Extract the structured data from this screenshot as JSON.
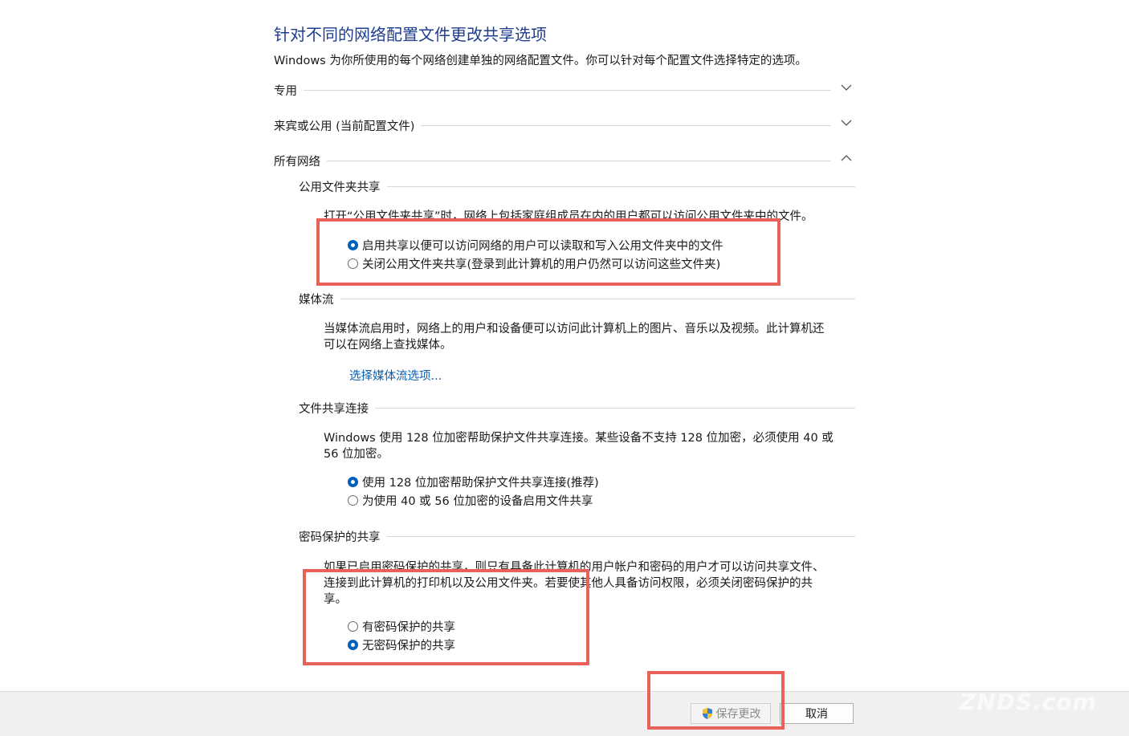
{
  "header": {
    "title": "针对不同的网络配置文件更改共享选项",
    "intro": "Windows 为你所使用的每个网络创建单独的网络配置文件。你可以针对每个配置文件选择特定的选项。"
  },
  "profiles": [
    {
      "label": "专用",
      "state": "collapsed",
      "icon": "chevron-down-icon"
    },
    {
      "label": "来宾或公用 (当前配置文件)",
      "state": "collapsed",
      "icon": "chevron-down-icon"
    },
    {
      "label": "所有网络",
      "state": "expanded",
      "icon": "chevron-up-icon"
    }
  ],
  "public_folder": {
    "heading": "公用文件夹共享",
    "desc": "打开“公用文件夹共享”时，网络上包括家庭组成员在内的用户都可以访问公用文件夹中的文件。",
    "options": [
      {
        "label": "启用共享以便可以访问网络的用户可以读取和写入公用文件夹中的文件",
        "selected": true
      },
      {
        "label": "关闭公用文件夹共享(登录到此计算机的用户仍然可以访问这些文件夹)",
        "selected": false
      }
    ]
  },
  "media": {
    "heading": "媒体流",
    "desc_line1": "当媒体流启用时，网络上的用户和设备便可以访问此计算机上的图片、音乐以及视频。此计算机还",
    "desc_line2": "可以在网络上查找媒体。",
    "link": "选择媒体流选项..."
  },
  "file_sharing": {
    "heading": "文件共享连接",
    "desc_line1": "Windows 使用 128 位加密帮助保护文件共享连接。某些设备不支持 128 位加密，必须使用 40 或",
    "desc_line2": "56 位加密。",
    "options": [
      {
        "label": "使用 128 位加密帮助保护文件共享连接(推荐)",
        "selected": true
      },
      {
        "label": "为使用 40 或 56 位加密的设备启用文件共享",
        "selected": false
      }
    ]
  },
  "password": {
    "heading": "密码保护的共享",
    "desc_line1": "如果已启用密码保护的共享，则只有具备此计算机的用户帐户和密码的用户才可以访问共享文件、",
    "desc_line2": "连接到此计算机的打印机以及公用文件夹。若要使其他人具备访问权限，必须关闭密码保护的共",
    "desc_line3": "享。",
    "options": [
      {
        "label": "有密码保护的共享",
        "selected": false
      },
      {
        "label": "无密码保护的共享",
        "selected": true
      }
    ]
  },
  "footer": {
    "save_label": "保存更改",
    "save_icon": "uac-shield-icon",
    "save_enabled": false,
    "cancel_label": "取消"
  },
  "watermark": "ZNDS.com",
  "colors": {
    "title": "#1e3d8f",
    "link": "#0b5cad",
    "radio_selected": "#005fb8",
    "annotation": "#e8625a",
    "footer_bg": "#f0f0f0"
  }
}
